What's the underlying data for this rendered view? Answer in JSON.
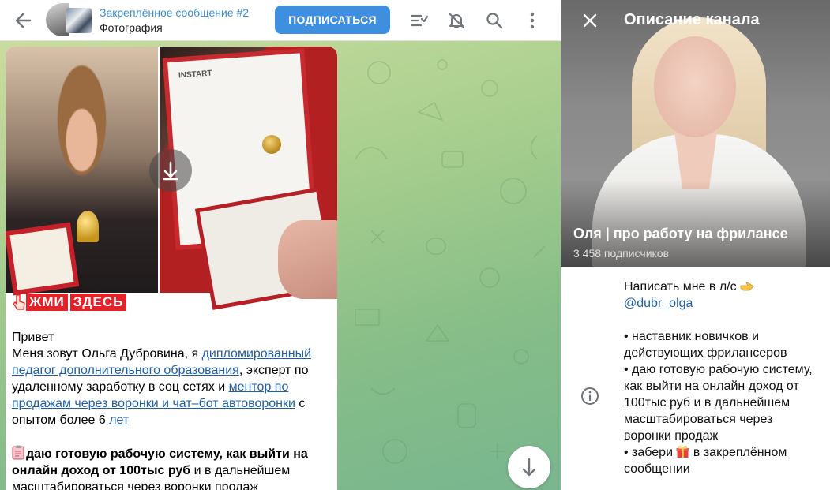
{
  "topbar": {
    "pinned_title": "Закреплённое сообщение #2",
    "pinned_subtitle": "Фотография",
    "subscribe_label": "ПОДПИСАТЬСЯ",
    "icons": [
      "back-arrow-icon",
      "poll-icon",
      "bell-off-icon",
      "search-icon",
      "more-vertical-icon"
    ]
  },
  "message": {
    "photo_brand": "INSTART",
    "banner": [
      "ЖМИ",
      "ЗДЕСЬ"
    ],
    "greeting": "Привет",
    "intro_before_link1": "Меня зовут Ольга Дубровина, я ",
    "link1": "дипломированный педагог дополнительного образования",
    "intro_after_link1": ", эксперт по удаленному заработку в соц сетях и ",
    "link2": "ментор по продажам через воронки и чат–бот автоворонки",
    "intro_after_link2": " с опытом более 6 ",
    "link3": "лет",
    "offer_bold": "даю готовую рабочую систему, как выйти на онлайн доход от 100тыс руб",
    "offer_rest": " и в дальнейшем масштабироваться через воронки продаж"
  },
  "panel": {
    "title": "Описание канала",
    "channel_name": "Оля | про работу на фрилансе",
    "subscribers": "3 458 подписчиков",
    "desc_line1": "Написать мне в л/с",
    "desc_username": "@dubr_olga",
    "bullet1": "• наставник новичков и действующих фрилансеров",
    "bullet2": "• даю готовую рабочую систему, как выйти на онлайн доход от 100тыс руб и в дальнейшем масштабироваться через воронки продаж",
    "bullet3_before": "• забери ",
    "bullet3_after": " в закреплённом сообщении"
  },
  "colors": {
    "accent": "#3e8fe0",
    "link": "#1f5fa8",
    "banner_red": "#e3222a"
  }
}
